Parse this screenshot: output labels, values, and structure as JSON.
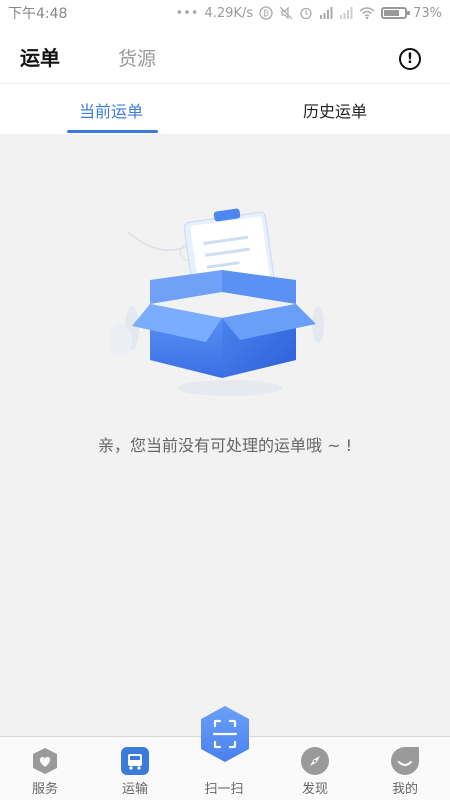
{
  "status_bar": {
    "time": "下午4:48",
    "network_speed": "4.29K/s",
    "battery": "73%",
    "battery_level": 0.73
  },
  "header": {
    "tabs": [
      {
        "label": "运单",
        "active": true
      },
      {
        "label": "货源",
        "active": false
      }
    ],
    "info_icon": "!"
  },
  "subtabs": [
    {
      "label": "当前运单",
      "active": true
    },
    {
      "label": "历史运单",
      "active": false
    }
  ],
  "empty_state": {
    "message": "亲，您当前没有可处理的运单哦 ~ !"
  },
  "bottom_nav": {
    "items": [
      {
        "label": "服务",
        "icon": "heart-shield-icon"
      },
      {
        "label": "运输",
        "icon": "bus-icon",
        "active": true
      },
      {
        "label": "扫一扫",
        "icon": "scan-icon"
      },
      {
        "label": "发现",
        "icon": "compass-icon"
      },
      {
        "label": "我的",
        "icon": "smile-icon"
      }
    ]
  },
  "colors": {
    "accent": "#3d7bdb",
    "background": "#f2f2f2",
    "nav_inactive": "#9a9a9a"
  }
}
